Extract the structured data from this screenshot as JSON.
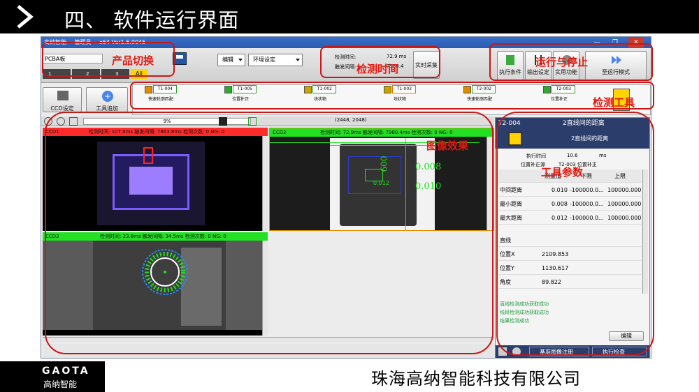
{
  "slide": {
    "title": "四、 软件运行界面",
    "company": "珠海高纳智能科技有限公司",
    "logo_text": "GAOTA",
    "logo_sub": "高纳智能"
  },
  "app": {
    "title": "高纳智能----管理员----x64 Ver1.6.0045",
    "product": "PCBA板",
    "product_tabs": [
      "1",
      "2",
      "3",
      "All"
    ],
    "menus": {
      "edit": "编辑",
      "env": "环境设定"
    },
    "timing": {
      "detect_time_label": "检测时间:",
      "detect_time_value": "72.9 ms",
      "trigger_label": "触发间隔:",
      "trigger_value": "7980.4",
      "realtime_button": "实时采集"
    },
    "right_buttons": [
      "执行条件",
      "输出设定",
      "实用功能",
      "至运行模式"
    ],
    "left_buttons": [
      "CCD设定",
      "工具追加"
    ],
    "tools": [
      {
        "id": "T1-004",
        "name": "快速轮廓匹配",
        "color": "#e07a00"
      },
      {
        "id": "T1-005",
        "name": "位置补正",
        "color": "#2fa82f"
      },
      {
        "id": "T1-002",
        "name": "块状物",
        "color": "#2fa82f"
      },
      {
        "id": "T1-003",
        "name": "块状物",
        "color": "#e07a00"
      },
      {
        "id": "T2-002",
        "name": "快速轮廓匹配",
        "color": "#2fa82f"
      },
      {
        "id": "T2-003",
        "name": "位置补正",
        "color": "#2fa82f"
      }
    ],
    "viewbar": {
      "zoom": "9%",
      "coords": "(2448, 2048)"
    },
    "ccd": [
      {
        "name": "CCD1",
        "stats": "检测时间:  107.0ms  触发间隔:  7863.8ms  检测次数:  0  NG: 0",
        "color": "#ff2b2b"
      },
      {
        "name": "CCD2",
        "stats": "检测时间:  72.9ms  触发间隔:  7980.4ms  检测次数:  0  NG: 0",
        "color": "#22e022"
      },
      {
        "name": "CCD3",
        "stats": "检测时间:  23.8ms  触发间隔:  34.5ms  检测次数:  0  NG: 0",
        "color": "#22e022"
      }
    ],
    "overlay": {
      "v1": "0.008",
      "v2": "0.010",
      "v3": "600",
      "v4": "0.012"
    },
    "tool_panel": {
      "id": "T2-004",
      "name": "2直线间的距离",
      "subname": "2直线间的距离",
      "exec_label": "执行时间",
      "exec_value": "10.6",
      "exec_unit": "ms",
      "comp_label": "位置补正源",
      "comp_value": "T2-003  位置补正",
      "headers": [
        "测量值",
        "下限",
        "上限"
      ],
      "rows": [
        {
          "name": "中间距离",
          "val": "0.010",
          "low": "-100000.0...",
          "high": "100000.000"
        },
        {
          "name": "最小距离",
          "val": "0.008",
          "low": "-100000.0...",
          "high": "100000.000"
        },
        {
          "name": "最大距离",
          "val": "0.012",
          "low": "-100000.0...",
          "high": "100000.000"
        }
      ],
      "line_section": "直线",
      "props": [
        {
          "name": "位置X",
          "val": "2109.853"
        },
        {
          "name": "位置Y",
          "val": "1130.617"
        },
        {
          "name": "角度",
          "val": "89.822"
        }
      ],
      "logs": [
        "直线检测成功获取成功",
        "线段检测成功获取成功",
        "结果检测成功"
      ],
      "edit_button": "编辑",
      "register_button": "基准图像注册",
      "run_button": "执行检查"
    }
  },
  "annotations": {
    "product_switch": "产品切换",
    "detect_time": "检测时间",
    "run_stop": "运行与停止",
    "detect_tool": "检测工具",
    "image_effect": "图像效果",
    "tool_params": "工具参数"
  },
  "colors": {
    "red": "#e5180e",
    "green": "#22e022",
    "blue_header": "#2b3d6b"
  }
}
